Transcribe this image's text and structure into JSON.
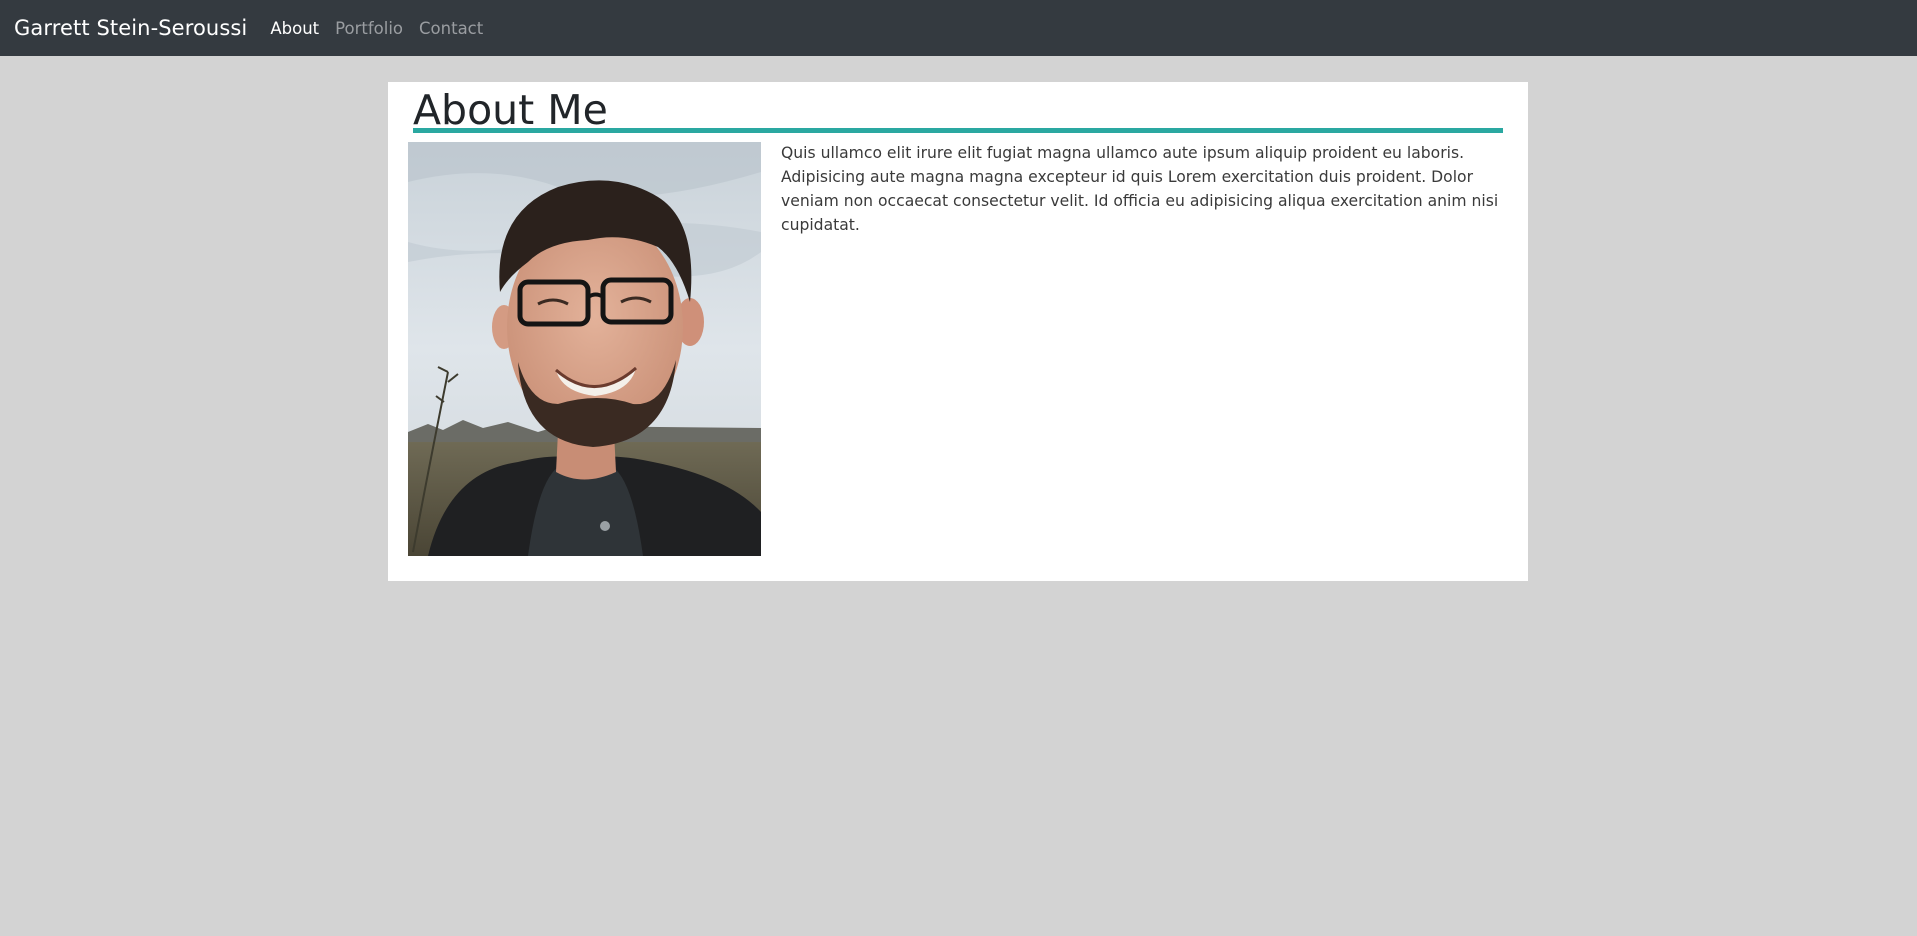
{
  "navbar": {
    "brand": "Garrett Stein-Seroussi",
    "links": [
      {
        "label": "About",
        "active": true
      },
      {
        "label": "Portfolio",
        "active": false
      },
      {
        "label": "Contact",
        "active": false
      }
    ]
  },
  "about": {
    "title": "About Me",
    "accent_color": "#2aa8a1",
    "bio": "Quis ullamco elit irure elit fugiat magna ullamco aute ipsum aliquip proident eu laboris. Adipisicing aute magna magna excepteur id quis Lorem exercitation duis proident. Dolor veniam non occaecat consectetur velit. Id officia eu adipisicing aliqua exercitation anim nisi cupidatat."
  }
}
